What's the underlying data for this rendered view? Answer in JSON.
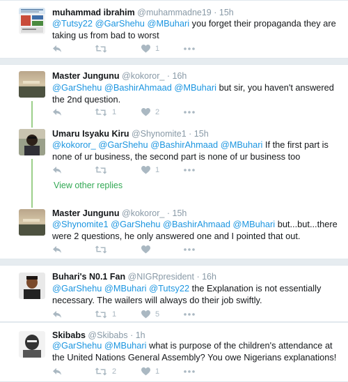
{
  "colors": {
    "link": "#1b95e0",
    "thread": "#9bcf89",
    "view_more": "#31a853",
    "muted": "#aab8c2"
  },
  "tweets": [
    {
      "name": "muhammad ibrahim",
      "handle": "@muhammadne19",
      "sep": "·",
      "time": "15h",
      "mentions": "@Tutsy22 @GarShehu @MBuhari",
      "body": " you forget their propaganda they are taking us from bad to worst",
      "retweets": "",
      "likes": "1"
    },
    {
      "name": "Master Jungunu",
      "handle": "@kokoror_",
      "sep": "·",
      "time": "16h",
      "mentions": "@GarShehu @BashirAhmaad @MBuhari",
      "body": " but sir, you haven't answered the 2nd question.",
      "retweets": "1",
      "likes": "2"
    },
    {
      "name": "Umaru Isyaku Kiru",
      "handle": "@Shynomite1",
      "sep": "·",
      "time": "15h",
      "mentions": "@kokoror_ @GarShehu @BashirAhmaad @MBuhari",
      "body": " If the first part is none of ur business, the second part is none of ur business too",
      "retweets": "",
      "likes": "1"
    },
    {
      "name": "Master Jungunu",
      "handle": "@kokoror_",
      "sep": "·",
      "time": "15h",
      "mentions": "@Shynomite1 @GarShehu @BashirAhmaad @MBuhari",
      "body": " but...but...there were 2 questions, he only answered one and I pointed that out.",
      "retweets": "",
      "likes": ""
    },
    {
      "name": "Buhari's N0.1 Fan",
      "handle": "@NIGRpresident",
      "sep": "·",
      "time": "16h",
      "mentions": "@GarShehu @MBuhari @Tutsy22",
      "body": " the Explanation is not essentially necessary. The wailers will always do their job swiftly.",
      "retweets": "1",
      "likes": "5"
    },
    {
      "name": "Skibabs",
      "handle": "@Skibabs",
      "sep": "·",
      "time": "1h",
      "mentions": "@GarShehu @MBuhari",
      "body": "  what is purpose of the children's attendance at the United Nations General Assembly? You owe Nigerians explanations!",
      "retweets": "2",
      "likes": "1"
    }
  ],
  "view_other_replies": "View other replies"
}
